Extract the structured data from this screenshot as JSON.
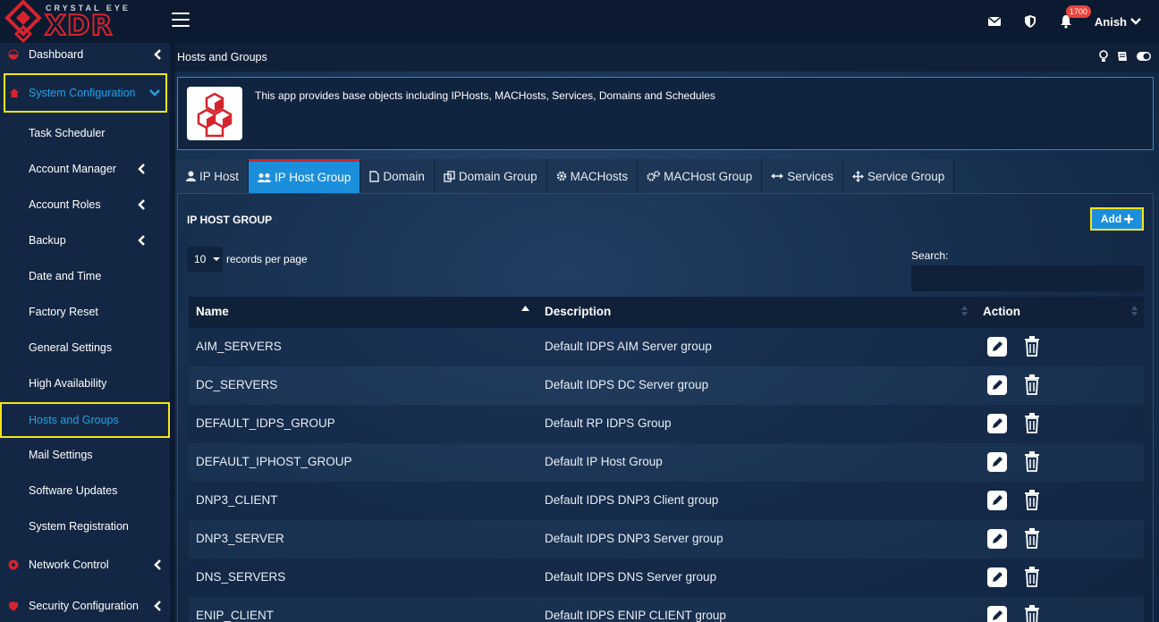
{
  "brand": {
    "name": "CRYSTAL EYE",
    "product": "XDR"
  },
  "topbar": {
    "notification_count": "1700",
    "user": "Anish"
  },
  "sidebar": {
    "items": [
      {
        "label": "Dashboard",
        "icon": "gauge-icon"
      },
      {
        "label": "System Configuration",
        "icon": "home-icon"
      },
      {
        "label": "Task Scheduler"
      },
      {
        "label": "Account Manager"
      },
      {
        "label": "Account Roles"
      },
      {
        "label": "Backup"
      },
      {
        "label": "Date and Time"
      },
      {
        "label": "Factory Reset"
      },
      {
        "label": "General Settings"
      },
      {
        "label": "High Availability"
      },
      {
        "label": "Hosts and Groups"
      },
      {
        "label": "Mail Settings"
      },
      {
        "label": "Software Updates"
      },
      {
        "label": "System Registration"
      },
      {
        "label": "Network Control",
        "icon": "network-icon"
      },
      {
        "label": "Security Configuration",
        "icon": "shield-icon"
      }
    ]
  },
  "page": {
    "title": "Hosts and Groups",
    "info": "This app provides base objects including IPHosts, MACHosts, Services, Domains and Schedules"
  },
  "tabs": [
    {
      "label": "IP Host",
      "icon": "user-icon"
    },
    {
      "label": "IP Host Group",
      "icon": "users-icon"
    },
    {
      "label": "Domain",
      "icon": "file-icon"
    },
    {
      "label": "Domain Group",
      "icon": "copy-icon"
    },
    {
      "label": "MACHosts",
      "icon": "gear-icon"
    },
    {
      "label": "MACHost Group",
      "icon": "gears-icon"
    },
    {
      "label": "Services",
      "icon": "arrows-h-icon"
    },
    {
      "label": "Service Group",
      "icon": "arrows-icon"
    }
  ],
  "panel": {
    "title": "IP HOST GROUP",
    "add_label": "Add",
    "per_page_value": "10",
    "per_page_label": "records per page",
    "search_label": "Search:",
    "search_value": ""
  },
  "table": {
    "columns": [
      "Name",
      "Description",
      "Action"
    ],
    "rows": [
      {
        "name": "AIM_SERVERS",
        "description": "Default IDPS AIM Server group"
      },
      {
        "name": "DC_SERVERS",
        "description": "Default IDPS DC Server group"
      },
      {
        "name": "DEFAULT_IDPS_GROUP",
        "description": "Default RP IDPS Group"
      },
      {
        "name": "DEFAULT_IPHOST_GROUP",
        "description": "Default IP Host Group"
      },
      {
        "name": "DNP3_CLIENT",
        "description": "Default IDPS DNP3 Client group"
      },
      {
        "name": "DNP3_SERVER",
        "description": "Default IDPS DNP3 Server group"
      },
      {
        "name": "DNS_SERVERS",
        "description": "Default IDPS DNS Server group"
      },
      {
        "name": "ENIP_CLIENT",
        "description": "Default IDPS ENIP CLIENT group"
      }
    ]
  },
  "colors": {
    "accent": "#1c8fdc",
    "highlight": "#f5e51b",
    "brand_red": "#d6242e",
    "active_text": "#1fa3e8"
  }
}
